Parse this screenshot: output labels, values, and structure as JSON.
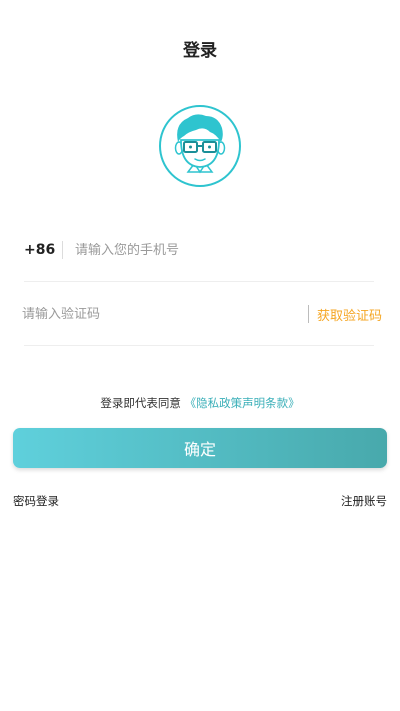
{
  "header": {
    "title": "登录"
  },
  "avatar": {
    "icon": "cartoon-man-with-glasses-avatar",
    "accent_color": "#2ec4cf"
  },
  "phone": {
    "country_code": "+86",
    "placeholder": "请输入您的手机号",
    "value": ""
  },
  "verification": {
    "placeholder": "请输入验证码",
    "value": "",
    "get_code_label": "获取验证码"
  },
  "agreement": {
    "prefix": "登录即代表同意",
    "link_text": "《隐私政策声明条款》"
  },
  "confirm_label": "确定",
  "links": {
    "password_login": "密码登录",
    "register": "注册账号"
  },
  "colors": {
    "button_gradient_start": "#5fd0dc",
    "button_gradient_end": "#48a9ac",
    "link": "#3aafb8",
    "get_code": "#f5a623"
  }
}
